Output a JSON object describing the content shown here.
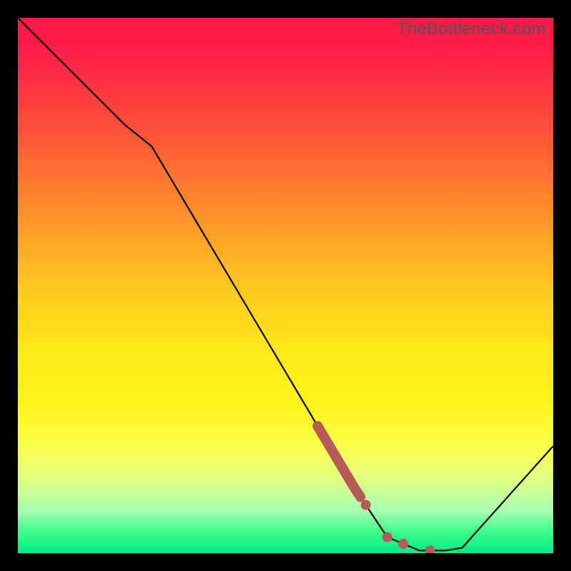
{
  "watermark": "TheBottleneck.com",
  "chart_data": {
    "type": "line",
    "title": "",
    "xlabel": "",
    "ylabel": "",
    "xlim": [
      0,
      100
    ],
    "ylim": [
      0,
      100
    ],
    "series": [
      {
        "name": "curve",
        "x": [
          0,
          20,
          25,
          60,
          63,
          69,
          75,
          80,
          83,
          100
        ],
        "values": [
          100,
          80,
          76,
          17,
          12,
          3,
          0.5,
          0.5,
          1,
          20
        ]
      }
    ],
    "highlight_segment": {
      "x_start": 56,
      "x_end": 64
    },
    "dots_x": [
      65,
      69,
      72,
      77
    ],
    "accent_color": "#b85a5a",
    "line_color": "#000000"
  }
}
